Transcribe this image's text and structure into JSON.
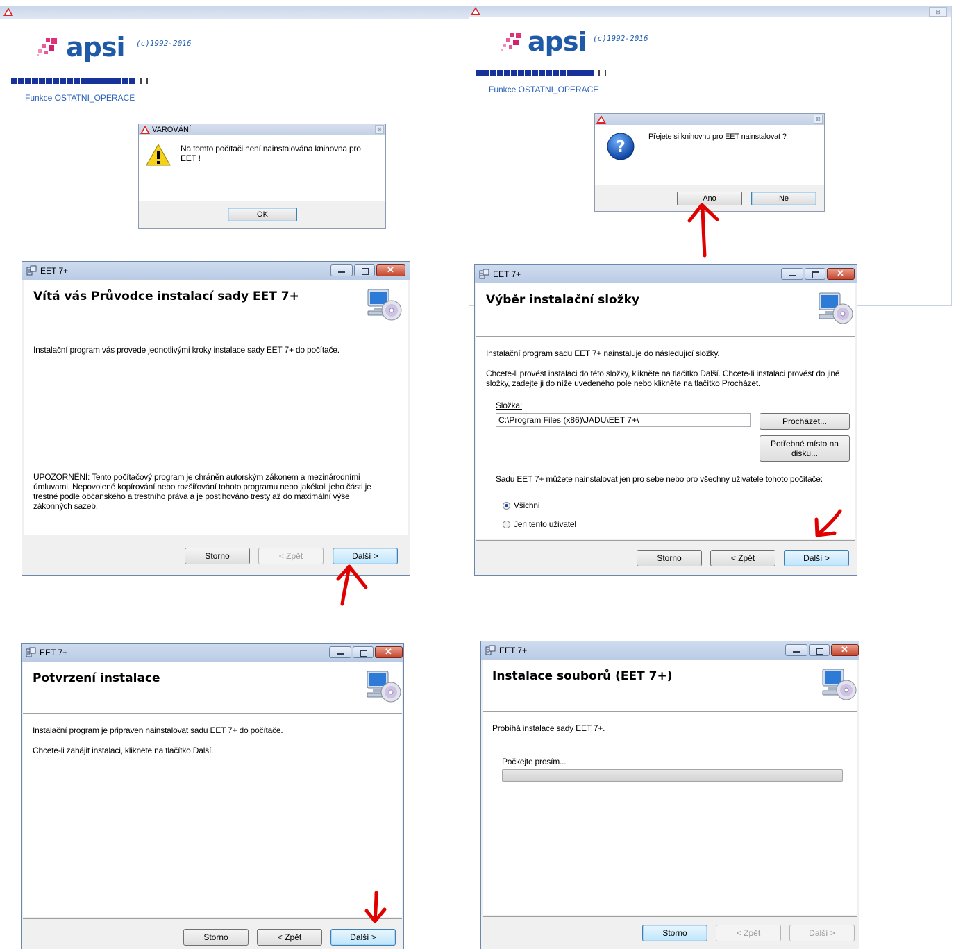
{
  "apsi": {
    "logo_text": "apsi",
    "copyright": "(c)1992-2016",
    "function_label": "Funkce OSTATNI_OPERACE",
    "close_glyph": "⊠"
  },
  "warning_dialog": {
    "title": "VAROVÁNÍ",
    "message": "Na tomto počítači není nainstalována knihovna pro EET !",
    "ok_label": "OK"
  },
  "question_dialog": {
    "message": "Přejete si knihovnu pro EET nainstalovat ?",
    "yes_label": "Ano",
    "no_label": "Ne"
  },
  "installer": {
    "window_title": "EET 7+",
    "buttons": {
      "cancel": "Storno",
      "back": "< Zpět",
      "next": "Další >"
    }
  },
  "welcome": {
    "heading": "Vítá vás Průvodce instalací sady EET 7+",
    "intro": "Instalační program vás provede jednotlivými kroky instalace sady EET 7+ do počítače.",
    "notice": "UPOZORNĚNÍ: Tento počítačový program je chráněn autorským zákonem a mezinárodními úmluvami. Nepovolené kopírování nebo rozšiřování tohoto programu nebo jakékoli jeho části je trestné podle občanského a trestního práva a je postihováno tresty až do maximální výše zákonných sazeb."
  },
  "folder": {
    "heading": "Výběr instalační složky",
    "intro": "Instalační program sadu EET 7+ nainstaluje do následující složky.",
    "instructions": "Chcete-li provést instalaci do této složky, klikněte na tlačítko Další. Chcete-li instalaci provést do jiné složky, zadejte ji do níže uvedeného pole nebo klikněte na tlačítko Procházet.",
    "folder_label": "Složka:",
    "folder_value": "C:\\Program Files (x86)\\JADU\\EET 7+\\",
    "browse_label": "Procházet...",
    "disk_cost_label": "Potřebné místo na disku...",
    "scope_text": "Sadu EET 7+ můžete nainstalovat jen pro sebe nebo pro všechny uživatele tohoto počítače:",
    "option_all": "Všichni",
    "option_me": "Jen tento uživatel",
    "selected_option": "Všichni"
  },
  "confirm": {
    "heading": "Potvrzení instalace",
    "line1": "Instalační program je připraven nainstalovat sadu EET 7+ do počítače.",
    "line2": "Chcete-li zahájit instalaci, klikněte na tlačítko Další."
  },
  "progress": {
    "heading": "Instalace souborů (EET 7+)",
    "line1": "Probíhá instalace sady EET 7+.",
    "wait_label": "Počkejte prosím...",
    "progress_fraction": 0
  },
  "colors": {
    "annotation_arrow": "#e00000",
    "apsi_blue": "#1f5aa8",
    "progress_blocks": "#17339b"
  }
}
